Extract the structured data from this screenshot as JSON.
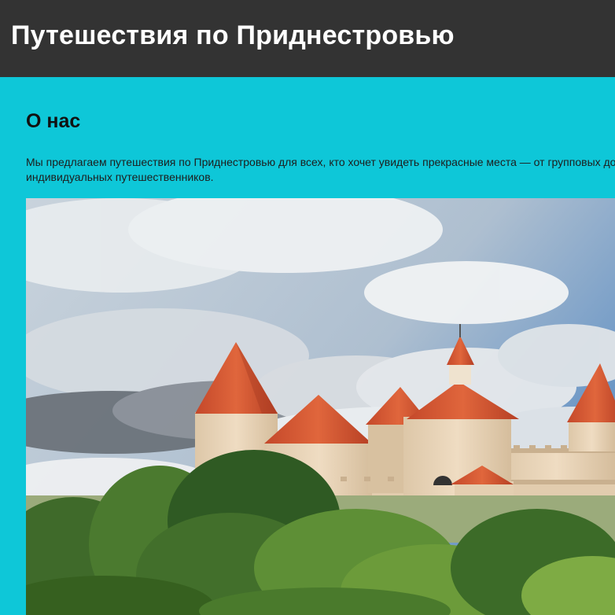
{
  "header": {
    "title": "Путешествия по Приднестровью"
  },
  "about": {
    "heading": "О нас",
    "text": "Мы предлагаем путешествия по Приднестровью для всех, кто хочет увидеть прекрасные места — от групповых до индивидуальных путешественников."
  },
  "photo": {
    "subject": "fortress-image"
  },
  "colors": {
    "header_bg": "#333333",
    "page_bg": "#0ec7d8",
    "roof": "#d2542f",
    "wall": "#e6d2b6"
  }
}
